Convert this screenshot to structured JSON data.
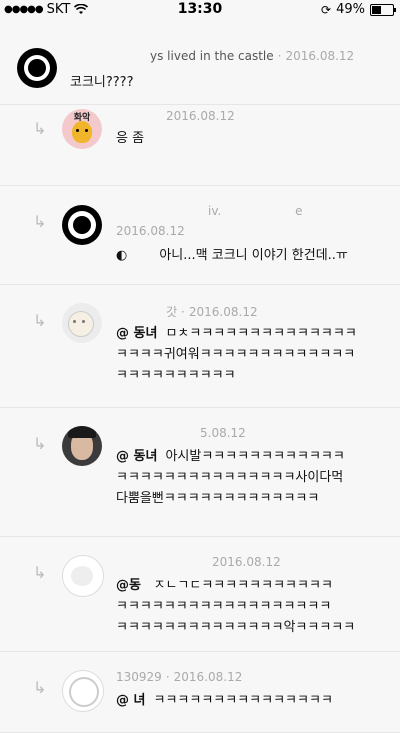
{
  "status": {
    "carrier": "SKT",
    "time": "13:30",
    "battery": "49%",
    "battery_level": 0.49
  },
  "comments": [
    {
      "author": "ys lived in the castle",
      "date": "2016.08.12",
      "lines": [
        "코크니????"
      ]
    },
    {
      "author": "",
      "date": "2016.08.12",
      "lines": [
        "응 좀"
      ],
      "avatar_text": "화악"
    },
    {
      "author": "iv.",
      "author2": "e",
      "date": "2016.08.12",
      "mention": "",
      "lines": [
        "아니...맥 코크니 이야기 한건데..ㅠ"
      ]
    },
    {
      "author": "갓",
      "date": "2016.08.12",
      "mention": "@ 동녀",
      "lines": [
        "ㅁㅊㅋㅋㅋㅋㅋㅋㅋㅋㅋㅋㅋㅋㅋㅋ",
        "ㅋㅋㅋㅋ귀여워ㅋㅋㅋㅋㅋㅋㅋㅋㅋㅋㅋㅋㅋ",
        "ㅋㅋㅋㅋㅋㅋㅋㅋㅋㅋ"
      ]
    },
    {
      "author": "",
      "date": "5.08.12",
      "mention": "@ 동녀",
      "lines": [
        "아시발ㅋㅋㅋㅋㅋㅋㅋㅋㅋㅋㅋㅋ",
        "ㅋㅋㅋㅋㅋㅋㅋㅋㅋㅋㅋㅋㅋㅋㅋ사이다먹",
        "다뿜을뻔ㅋㅋㅋㅋㅋㅋㅋㅋㅋㅋㅋㅋㅋ"
      ]
    },
    {
      "author": "",
      "date": "2016.08.12",
      "mention": "@동 ",
      "lines": [
        "ㅈㄴㄱㄷㅋㅋㅋㅋㅋㅋㅋㅋㅋㅋㅋ",
        "ㅋㅋㅋㅋㅋㅋㅋㅋㅋㅋㅋㅋㅋㅋㅋㅋㅋㅋ",
        "ㅋㅋㅋㅋㅋㅋㅋㅋㅋㅋㅋㅋㅋㅋ악ㅋㅋㅋㅋㅋ"
      ]
    },
    {
      "author": "130929",
      "date": "2016.08.12",
      "mention": "@ 녀",
      "lines": [
        "ㅋㅋㅋㅋㅋㅋㅋㅋㅋㅋㅋㅋㅋㅋㅋ"
      ]
    }
  ]
}
